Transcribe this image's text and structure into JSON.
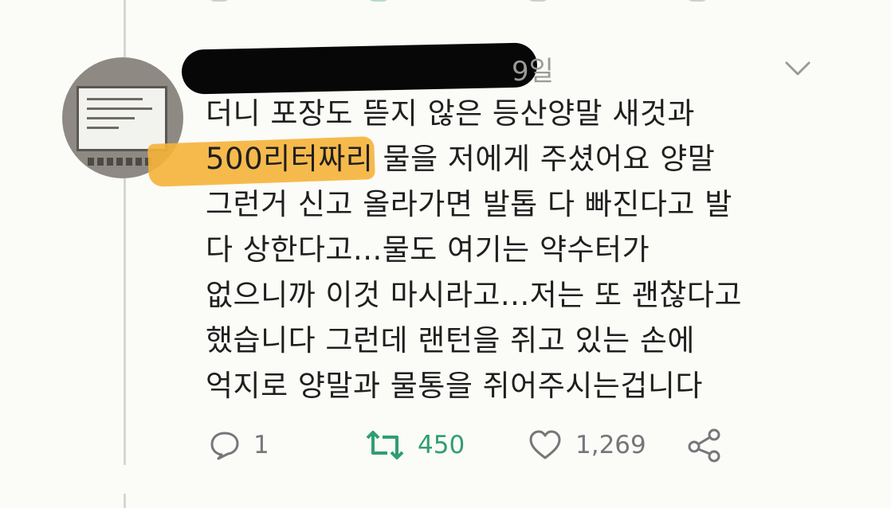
{
  "tweet": {
    "timestamp_visible": "9일",
    "text_lines": [
      "더니 포장도 뜯지 않은 등산양말 새것과",
      "500리터짜리 물을 저에게 주셨어요 양말",
      "그런거 신고 올라가면 발톱 다 빠진다고 발",
      "다 상한다고...물도 여기는 약수터가",
      "없으니까 이것 마시라고...저는 또 괜찮다고",
      "했습니다 그런데 랜턴을 쥐고 있는 손에",
      "억지로 양말과 물통을 쥐어주시는겁니다"
    ],
    "highlighted_text": "500리터짜리",
    "actions": {
      "reply": {
        "icon": "reply-bubble-icon",
        "count": "1"
      },
      "retweet": {
        "icon": "retweet-icon",
        "count": "450",
        "color": "#2f9e71"
      },
      "like": {
        "icon": "heart-icon",
        "count": "1,269"
      },
      "share": {
        "icon": "share-icon"
      }
    },
    "menu_icon": "chevron-down-icon"
  },
  "colors": {
    "background": "#fbfbf8",
    "text": "#1f1f1f",
    "muted": "#76767a",
    "highlight": "#f5b338",
    "redaction": "#070707"
  }
}
